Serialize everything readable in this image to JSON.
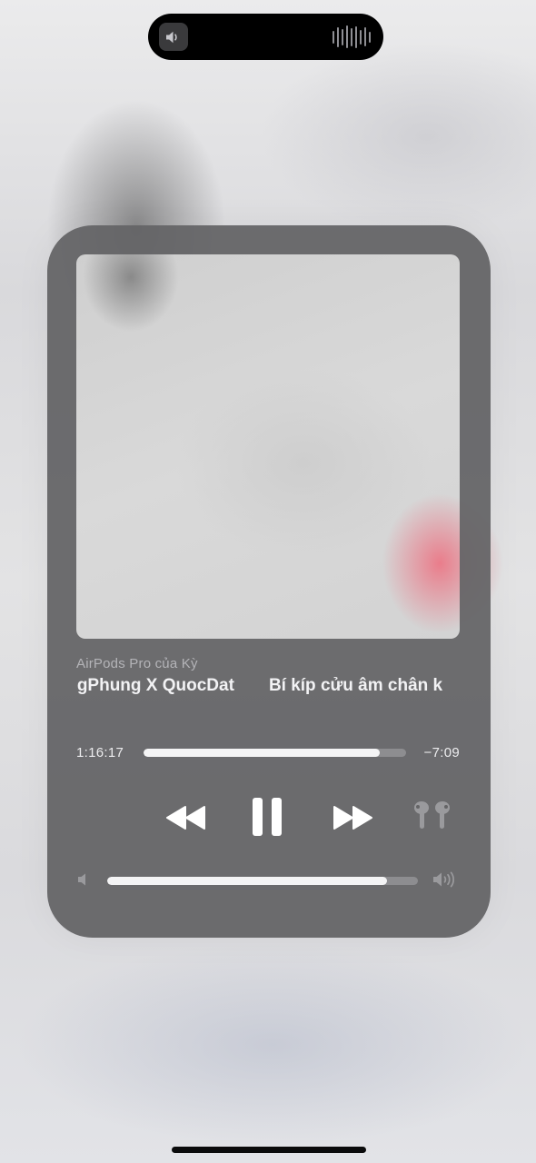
{
  "island": {
    "speaker_icon": "speaker-icon",
    "waveform_icon": "waveform-icon",
    "waveform_color": "#8e8e93"
  },
  "player": {
    "output_device": "AirPods Pro của Kỳ",
    "title_fragment_a": "onggPhung X QuocDat",
    "title_fragment_b": "Bí kíp cửu âm chân k",
    "elapsed": "1:16:17",
    "remaining": "−7:09",
    "progress": 0.9,
    "volume": 0.9,
    "controls": {
      "rewind_icon": "rewind-icon",
      "pause_icon": "pause-icon",
      "forward_icon": "fast-forward-icon",
      "airplay_icon": "airpods-icon"
    },
    "colors": {
      "card": "#646466",
      "track": "#8d8d90",
      "fill": "#f4f4f5",
      "label": "#b4b4b8"
    }
  }
}
